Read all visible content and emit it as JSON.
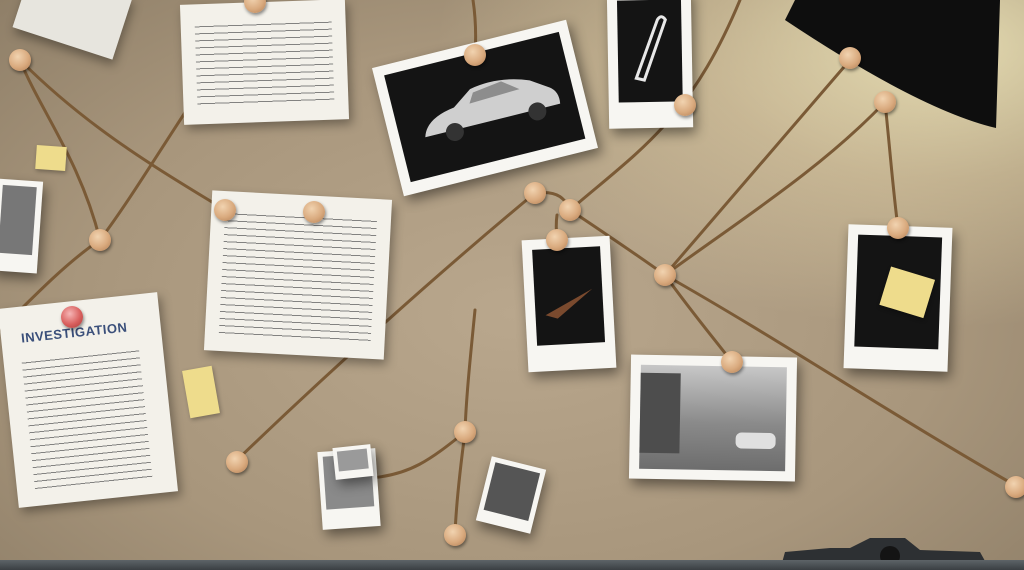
{
  "scene": {
    "board_color": "#b09d84",
    "string_color": "#7a5a36",
    "lamp_color": "#0e0e0e",
    "investigation_title": "INVESTIGATION"
  }
}
